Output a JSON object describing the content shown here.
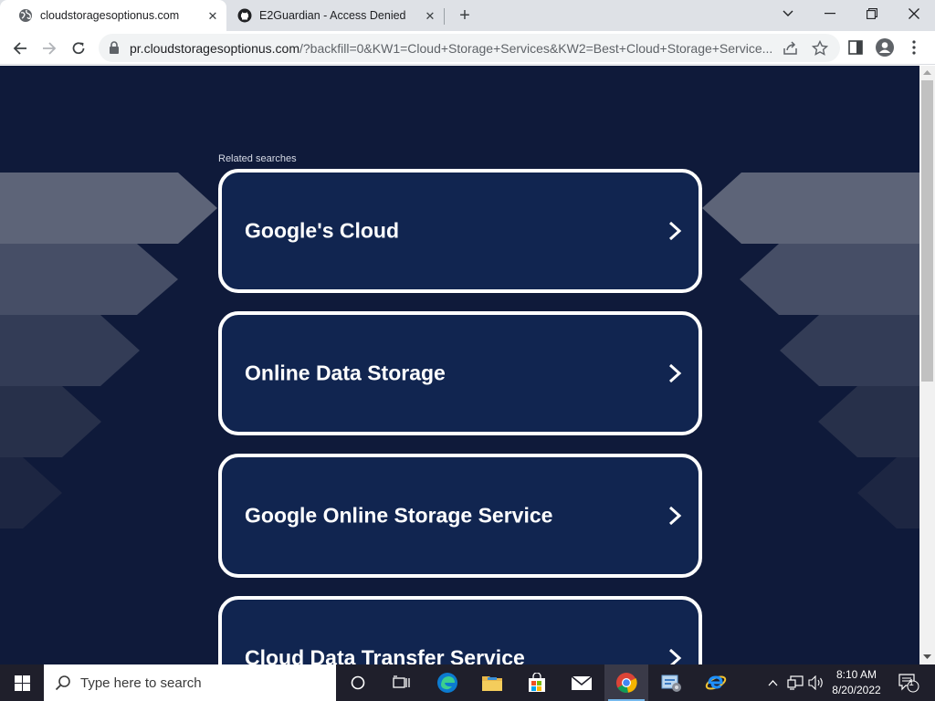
{
  "browser": {
    "tabs": [
      {
        "title": "cloudstoragesoptionus.com",
        "active": true,
        "close": "✕"
      },
      {
        "title": "E2Guardian - Access Denied",
        "active": false,
        "close": "✕"
      }
    ],
    "new_tab": "+",
    "window_controls": {
      "tab_search": "⌄",
      "minimize": "—",
      "restore": "❐",
      "close": "✕"
    },
    "address": {
      "host": "pr.cloudstoragesoptionus.com",
      "path": "/?backfill=0&KW1=Cloud+Storage+Services&KW2=Best+Cloud+Storage+Service..."
    }
  },
  "page": {
    "related_title": "Related searches",
    "results": [
      {
        "label": "Google's Cloud"
      },
      {
        "label": "Online Data Storage"
      },
      {
        "label": "Google Online Storage Service"
      },
      {
        "label": "Cloud Data Transfer Service"
      }
    ]
  },
  "taskbar": {
    "search_placeholder": "Type here to search",
    "time": "8:10 AM",
    "date": "8/20/2022",
    "notification_count": "1"
  },
  "colors": {
    "page_bg": "#0f1a3a",
    "card_bg": "#112550",
    "card_border": "#ffffff",
    "taskbar_bg": "#1f1f2b",
    "tabstrip_bg": "#dee1e6"
  }
}
